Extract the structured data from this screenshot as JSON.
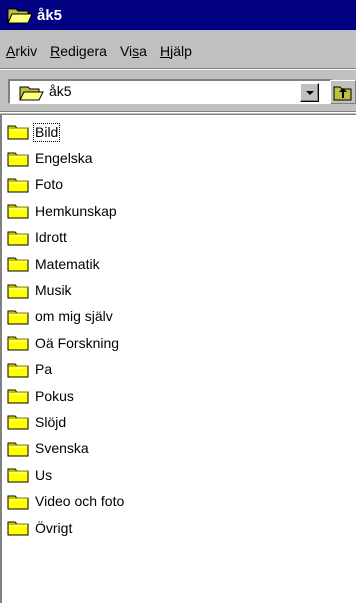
{
  "window": {
    "title": "åk5"
  },
  "menu": [
    {
      "accel": "A",
      "rest": "rkiv"
    },
    {
      "accel": "R",
      "rest": "edigera"
    },
    {
      "pre": "Vi",
      "accel": "s",
      "rest": "a"
    },
    {
      "accel": "H",
      "rest": "jälp"
    }
  ],
  "address": {
    "value": "åk5"
  },
  "folders": [
    {
      "label": "Bild"
    },
    {
      "label": "Engelska"
    },
    {
      "label": "Foto"
    },
    {
      "label": "Hemkunskap"
    },
    {
      "label": "Idrott"
    },
    {
      "label": "Matematik"
    },
    {
      "label": "Musik"
    },
    {
      "label": "om mig själv"
    },
    {
      "label": "Oä Forskning"
    },
    {
      "label": "Pa"
    },
    {
      "label": "Pokus"
    },
    {
      "label": "Slöjd"
    },
    {
      "label": "Svenska"
    },
    {
      "label": "Us"
    },
    {
      "label": "Video och foto"
    },
    {
      "label": "Övrigt"
    }
  ],
  "colors": {
    "titlebar": "#000080",
    "folder": "#ffff00",
    "window": "#c0c0c0"
  },
  "icons": {
    "folder": "folder-icon",
    "open_folder": "open-folder-icon",
    "up_folder": "up-folder-icon"
  }
}
